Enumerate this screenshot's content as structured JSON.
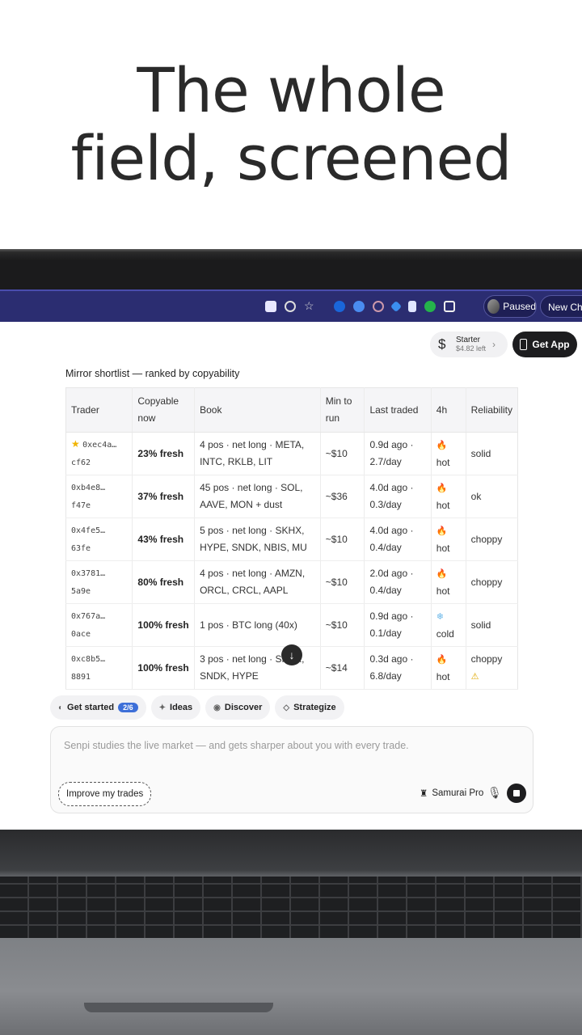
{
  "headline": {
    "line1": "The whole",
    "line2": "field, screened"
  },
  "browser": {
    "profile_status": "Paused",
    "new_chrome_label": "New Chro"
  },
  "header": {
    "plan_title": "Starter",
    "plan_balance": "$4.82 left",
    "plan_currency": "$",
    "get_app_label": "Get App"
  },
  "shortlist": {
    "title": "Mirror shortlist — ranked by copyability",
    "columns": [
      "Trader",
      "Copyable now",
      "Book",
      "Min to run",
      "Last traded",
      "4h",
      "Reliability"
    ],
    "rows": [
      {
        "trader_a": "0xec4a…",
        "trader_b": "cf62",
        "starred": true,
        "copyable": "23% fresh",
        "book_a": "4 pos · net long · META,",
        "book_b": "INTC, RKLB, LIT",
        "min": "~$10",
        "last_a": "0.9d ago ·",
        "last_b": "2.7/day",
        "h4_icon": "fire",
        "h4": "hot",
        "reliability": "solid",
        "warn": false
      },
      {
        "trader_a": "0xb4e8…",
        "trader_b": "f47e",
        "starred": false,
        "copyable": "37% fresh",
        "book_a": "45 pos · net long · SOL,",
        "book_b": "AAVE, MON + dust",
        "min": "~$36",
        "last_a": "4.0d ago ·",
        "last_b": "0.3/day",
        "h4_icon": "fire",
        "h4": "hot",
        "reliability": "ok",
        "warn": false
      },
      {
        "trader_a": "0x4fe5…",
        "trader_b": "63fe",
        "starred": false,
        "copyable": "43% fresh",
        "book_a": "5 pos · net long · SKHX,",
        "book_b": "HYPE, SNDK, NBIS, MU",
        "min": "~$10",
        "last_a": "4.0d ago ·",
        "last_b": "0.4/day",
        "h4_icon": "fire",
        "h4": "hot",
        "reliability": "choppy",
        "warn": false
      },
      {
        "trader_a": "0x3781…",
        "trader_b": "5a9e",
        "starred": false,
        "copyable": "80% fresh",
        "book_a": "4 pos · net long · AMZN,",
        "book_b": "ORCL, CRCL, AAPL",
        "min": "~$10",
        "last_a": "2.0d ago ·",
        "last_b": "0.4/day",
        "h4_icon": "fire",
        "h4": "hot",
        "reliability": "choppy",
        "warn": false
      },
      {
        "trader_a": "0x767a…",
        "trader_b": "0ace",
        "starred": false,
        "copyable": "100% fresh",
        "book_a": "1 pos · BTC long (40x)",
        "book_b": "",
        "min": "~$10",
        "last_a": "0.9d ago ·",
        "last_b": "0.1/day",
        "h4_icon": "snow",
        "h4": "cold",
        "reliability": "solid",
        "warn": false
      },
      {
        "trader_a": "0xc8b5…",
        "trader_b": "8891",
        "starred": false,
        "copyable": "100% fresh",
        "book_a": "3 pos · net long · SKHX,",
        "book_b": "SNDK, HYPE",
        "min": "~$14",
        "last_a": "0.3d ago ·",
        "last_b": "6.8/day",
        "h4_icon": "fire",
        "h4": "hot",
        "reliability": "choppy",
        "warn": true
      }
    ]
  },
  "chips": {
    "get_started": "Get started",
    "get_started_badge": "2/6",
    "ideas": "Ideas",
    "discover": "Discover",
    "strategize": "Strategize"
  },
  "composer": {
    "placeholder": "Senpi studies the live market — and gets sharper about you with every trade.",
    "improve_label": "Improve my trades",
    "model_label": "Samurai Pro"
  },
  "colors": {
    "browser_bar": "#2b2d71",
    "badge": "#3d6fd8",
    "fire": "#e8571c",
    "cold": "#67b6e8"
  }
}
